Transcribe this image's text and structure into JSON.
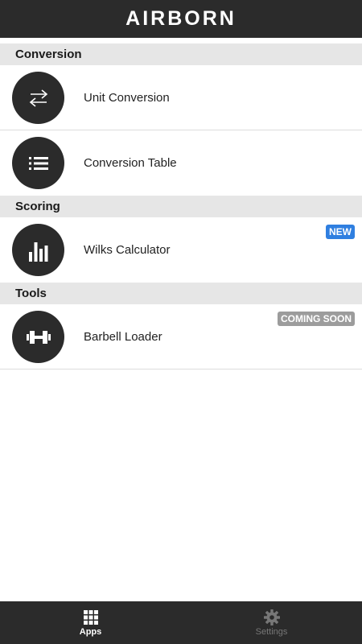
{
  "header": {
    "title": "AIRBORN",
    "background": "#2b2b2b"
  },
  "sections": [
    {
      "title": "Conversion",
      "items": [
        {
          "label": "Unit Conversion",
          "icon": "swap-arrows-icon"
        },
        {
          "label": "Conversion Table",
          "icon": "list-icon"
        }
      ]
    },
    {
      "title": "Scoring",
      "items": [
        {
          "label": "Wilks Calculator",
          "icon": "bar-chart-icon",
          "badge": "NEW"
        }
      ]
    },
    {
      "title": "Tools",
      "items": [
        {
          "label": "Barbell Loader",
          "icon": "dumbbell-icon",
          "badge": "COMING SOON"
        }
      ]
    }
  ],
  "tabbar": {
    "tabs": [
      {
        "label": "Apps",
        "icon": "grid-icon",
        "active": true
      },
      {
        "label": "Settings",
        "icon": "gear-icon",
        "active": false
      }
    ]
  },
  "colors": {
    "accent_new": "#2f7fe0",
    "badge_soon": "#9c9c9c",
    "dark": "#2b2b2b",
    "section_bg": "#e6e6e6"
  }
}
